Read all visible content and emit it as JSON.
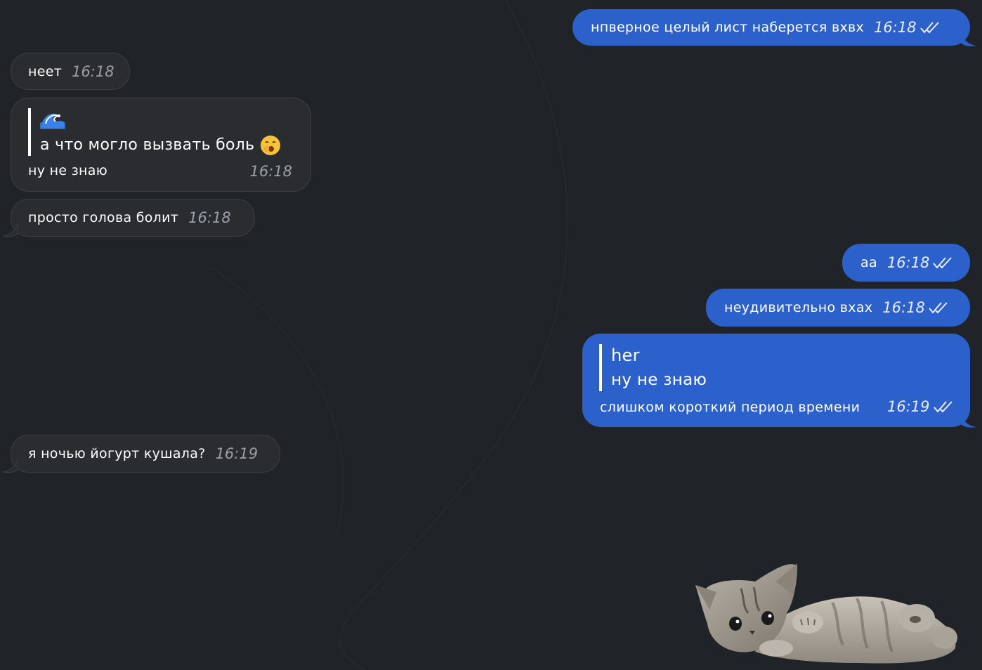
{
  "colors": {
    "background": "#202327",
    "incoming_bubble": "#2b2c2f",
    "outgoing_bubble": "#2c61cb",
    "incoming_time": "#9aa0aa"
  },
  "messages": [
    {
      "direction": "outgoing",
      "text": "нпверное целый лист наберется вхвх",
      "time": "16:18",
      "status_icon": "double-check-icon"
    },
    {
      "direction": "incoming",
      "text": "неет",
      "time": "16:18"
    },
    {
      "direction": "incoming",
      "reply_emoji": "wave-emoji",
      "reply_text": "а что могло вызвать боль",
      "reply_trailing_emoji": "yawning-face-emoji",
      "text": "ну не знаю",
      "time": "16:18"
    },
    {
      "direction": "incoming",
      "text": "просто голова болит",
      "time": "16:18"
    },
    {
      "direction": "outgoing",
      "text": "аа",
      "time": "16:18",
      "status_icon": "double-check-icon"
    },
    {
      "direction": "outgoing",
      "text": "неудивительно вхах",
      "time": "16:18",
      "status_icon": "double-check-icon"
    },
    {
      "direction": "outgoing",
      "reply_author": "her",
      "reply_text": "ну не знаю",
      "text": "слишком короткий период времени",
      "time": "16:19",
      "status_icon": "double-check-icon"
    },
    {
      "direction": "incoming",
      "text": "я ночью йогурт кушала?",
      "time": "16:19"
    }
  ],
  "sticker": {
    "icon": "kitten-sticker"
  }
}
